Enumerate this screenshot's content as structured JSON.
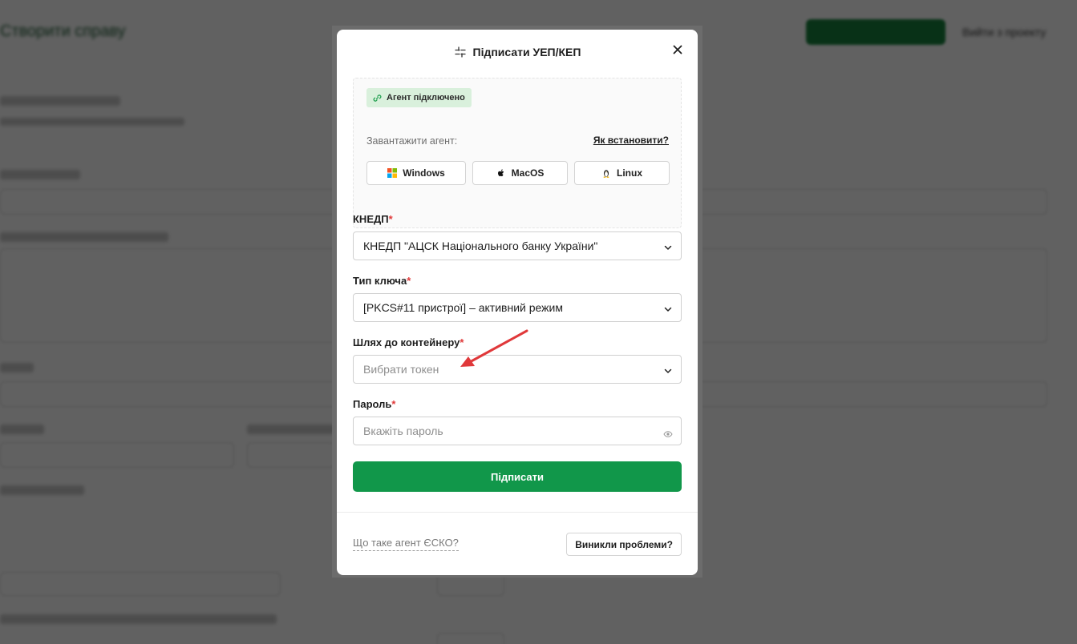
{
  "modal": {
    "title": "Підписати УЕП/КЕП",
    "agent_status": "Агент підключено",
    "download_label": "Завантажити агент:",
    "how_to_install": "Як встановити?",
    "os_buttons": [
      "Windows",
      "MacOS",
      "Linux"
    ],
    "fields": {
      "kned": {
        "label": "КНЕДП",
        "required_mark": "*",
        "value": "КНЕДП \"АЦСК Національного банку України\""
      },
      "key_type": {
        "label": "Тип ключа",
        "required_mark": "*",
        "value": "[PKCS#11 пристрої] – активний режим"
      },
      "container": {
        "label": "Шлях до контейнеру",
        "required_mark": "*",
        "placeholder": "Вибрати токен"
      },
      "password": {
        "label": "Пароль",
        "required_mark": "*",
        "placeholder": "Вкажіть пароль"
      }
    },
    "submit_label": "Підписати",
    "footer_link": "Що таке агент ЄСКО?",
    "problems_button": "Виникли проблеми?"
  },
  "colors": {
    "primary": "#11974a",
    "badge_bg": "#d9f0dc",
    "required": "#e03a3a",
    "annotation_arrow": "#e0383a"
  }
}
